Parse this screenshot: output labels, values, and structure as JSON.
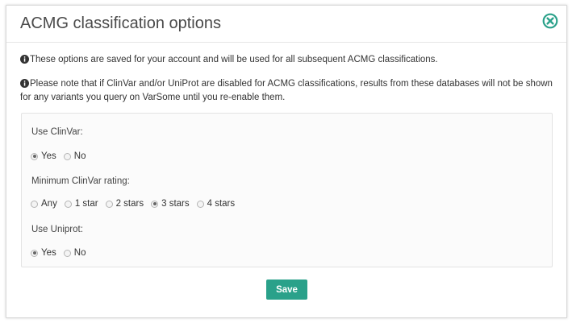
{
  "modal": {
    "title": "ACMG classification options",
    "close_icon": "close-circle-icon",
    "notes": [
      "These options are saved for your account and will  be used for all subsequent ACMG classifications.",
      "Please note that if ClinVar and/or UniProt are  disabled for ACMG classifications, results from  these databases will not be shown for any  variants you query on VarSome until you re-enable them."
    ],
    "info_icon": "info-circle-icon"
  },
  "options": {
    "clinvar": {
      "label": "Use ClinVar:",
      "choices": [
        "Yes",
        "No"
      ],
      "selected": "Yes"
    },
    "clinvar_rating": {
      "label": "Minimum ClinVar rating:",
      "choices": [
        "Any",
        "1 star",
        "2 stars",
        "3 stars",
        "4 stars"
      ],
      "selected": "3 stars"
    },
    "uniprot": {
      "label": "Use Uniprot:",
      "choices": [
        "Yes",
        "No"
      ],
      "selected": "Yes"
    }
  },
  "footer": {
    "save_label": "Save"
  },
  "colors": {
    "accent": "#2aa18a",
    "close_icon": "#2aa18a"
  }
}
